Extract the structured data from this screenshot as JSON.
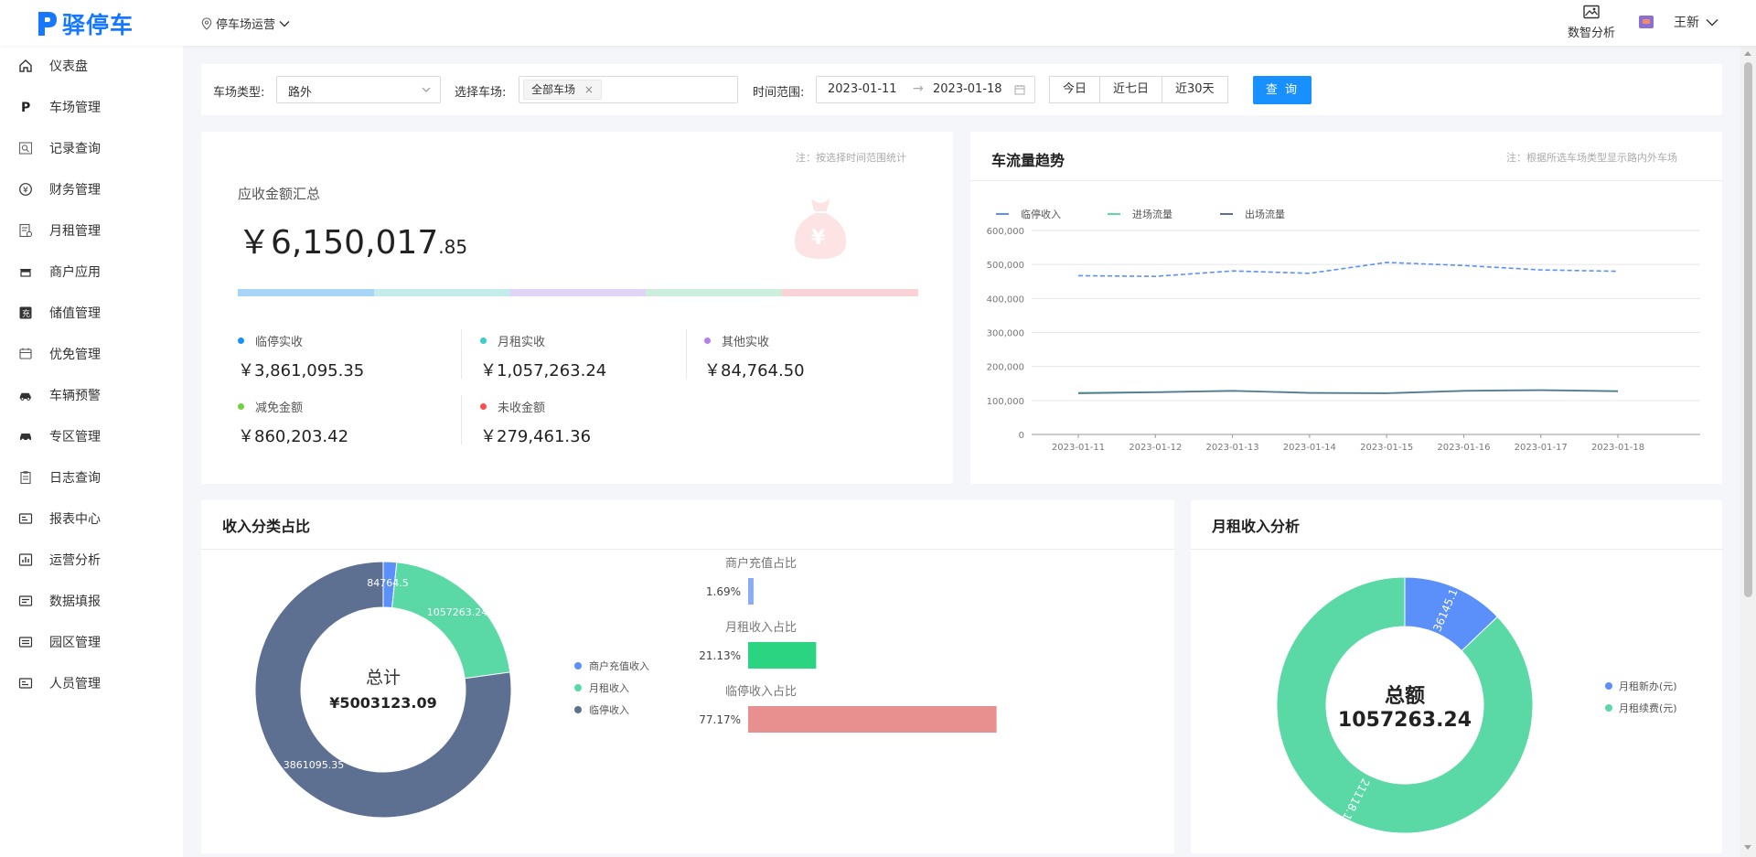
{
  "app": {
    "name": "驿停车",
    "brand_color": "#1677ff"
  },
  "header": {
    "lot_selector": "停车场运营",
    "analysis_label": "数智分析",
    "user_name": "王新"
  },
  "sidebar": {
    "items": [
      {
        "label": "仪表盘",
        "icon": "home-icon"
      },
      {
        "label": "车场管理",
        "icon": "parking-p-icon"
      },
      {
        "label": "记录查询",
        "icon": "search-record-icon"
      },
      {
        "label": "财务管理",
        "icon": "yuan-coin-icon"
      },
      {
        "label": "月租管理",
        "icon": "monthly-rent-icon"
      },
      {
        "label": "商户应用",
        "icon": "shop-icon"
      },
      {
        "label": "储值管理",
        "icon": "stored-value-icon"
      },
      {
        "label": "优免管理",
        "icon": "coupon-icon"
      },
      {
        "label": "车辆预警",
        "icon": "car-warning-icon"
      },
      {
        "label": "专区管理",
        "icon": "car-zone-icon"
      },
      {
        "label": "日志查询",
        "icon": "log-clipboard-icon"
      },
      {
        "label": "报表中心",
        "icon": "report-icon"
      },
      {
        "label": "运营分析",
        "icon": "bar-analysis-icon"
      },
      {
        "label": "数据填报",
        "icon": "data-entry-icon"
      },
      {
        "label": "园区管理",
        "icon": "park-icon"
      },
      {
        "label": "人员管理",
        "icon": "staff-icon"
      }
    ]
  },
  "filters": {
    "lot_type_label": "车场类型:",
    "lot_type_value": "路外",
    "lot_label": "选择车场:",
    "lot_tag": "全部车场",
    "time_label": "时间范围:",
    "date_start": "2023-01-11",
    "date_end": "2023-01-18",
    "quick_ranges": [
      "今日",
      "近七日",
      "近30天"
    ],
    "query_button": "查 询"
  },
  "summary": {
    "note": "注：按选择时间范围统计",
    "title": "应收金额汇总",
    "currency": "￥",
    "amount_int": "6,150,017",
    "amount_dec": ".85",
    "bar_colors": [
      "#a8d4f7",
      "#c3ecea",
      "#e2d4f5",
      "#cceedd",
      "#fad3d8"
    ],
    "stats": [
      {
        "label": "临停实收",
        "value": "￥3,861,095.35",
        "color": "#1890ff"
      },
      {
        "label": "月租实收",
        "value": "￥1,057,263.24",
        "color": "#36cfc9"
      },
      {
        "label": "其他实收",
        "value": "￥84,764.50",
        "color": "#b37feb"
      },
      {
        "label": "减免金额",
        "value": "￥860,203.42",
        "color": "#73d13d"
      },
      {
        "label": "未收金额",
        "value": "￥279,461.36",
        "color": "#ff4d4f"
      }
    ]
  },
  "trend": {
    "title": "车流量趋势",
    "note": "注：根据所选车场类型显示路内外车场",
    "legend": [
      "临停收入",
      "进场流量",
      "出场流量"
    ],
    "legend_colors": [
      "#5b8ff9",
      "#5ad8a6",
      "#5d7092"
    ],
    "chart_data": {
      "type": "line",
      "x": [
        "2023-01-11",
        "2023-01-12",
        "2023-01-13",
        "2023-01-14",
        "2023-01-15",
        "2023-01-16",
        "2023-01-17",
        "2023-01-18"
      ],
      "ylim": [
        0,
        600000
      ],
      "yticks": [
        "0",
        "100,000",
        "200,000",
        "300,000",
        "400,000",
        "500,000",
        "600,000"
      ],
      "series": [
        {
          "name": "临停收入",
          "values": [
            467000,
            465000,
            481000,
            474000,
            506000,
            497000,
            484000,
            480000
          ],
          "color": "#5b8ff9",
          "dashed": true
        },
        {
          "name": "进场流量",
          "values": [
            123000,
            125000,
            129000,
            123000,
            122000,
            129000,
            131000,
            128000
          ],
          "color": "#5ad8a6"
        },
        {
          "name": "出场流量",
          "values": [
            121000,
            124000,
            128000,
            122000,
            121000,
            128000,
            130000,
            127000
          ],
          "color": "#5d7092"
        }
      ]
    }
  },
  "income": {
    "title": "收入分类占比",
    "center_label": "总计",
    "center_value": "¥5003123.09",
    "legend": [
      {
        "label": "商户充值收入",
        "color": "#5b8ff9"
      },
      {
        "label": "月租收入",
        "color": "#5ad8a6"
      },
      {
        "label": "临停收入",
        "color": "#5d7092"
      }
    ],
    "chart_data": {
      "type": "pie",
      "categories": [
        "商户充值收入",
        "月租收入",
        "临停收入"
      ],
      "values": [
        84764.5,
        1057263.24,
        3861095.35
      ],
      "labels": [
        "84764.5",
        "1057263.24",
        "3861095.35"
      ]
    },
    "ratio_bars": [
      {
        "title": "商户充值占比",
        "percent_label": "1.69%",
        "value": 1.69,
        "color": "#8aabf7"
      },
      {
        "title": "月租收入占比",
        "percent_label": "21.13%",
        "value": 21.13,
        "color": "#2bd480"
      },
      {
        "title": "临停收入占比",
        "percent_label": "77.17%",
        "value": 77.17,
        "color": "#e8908f"
      }
    ]
  },
  "monthly": {
    "title": "月租收入分析",
    "center_label": "总额",
    "center_value": "1057263.24",
    "legend": [
      {
        "label": "月租新办(元)",
        "color": "#5b8ff9"
      },
      {
        "label": "月租续费(元)",
        "color": "#5ad8a6"
      }
    ],
    "chart_data": {
      "type": "pie",
      "categories": [
        "月租新办(元)",
        "月租续费(元)"
      ],
      "values": [
        136145.12,
        921118.12
      ],
      "labels": [
        "36145.1",
        "21118.1"
      ]
    }
  }
}
